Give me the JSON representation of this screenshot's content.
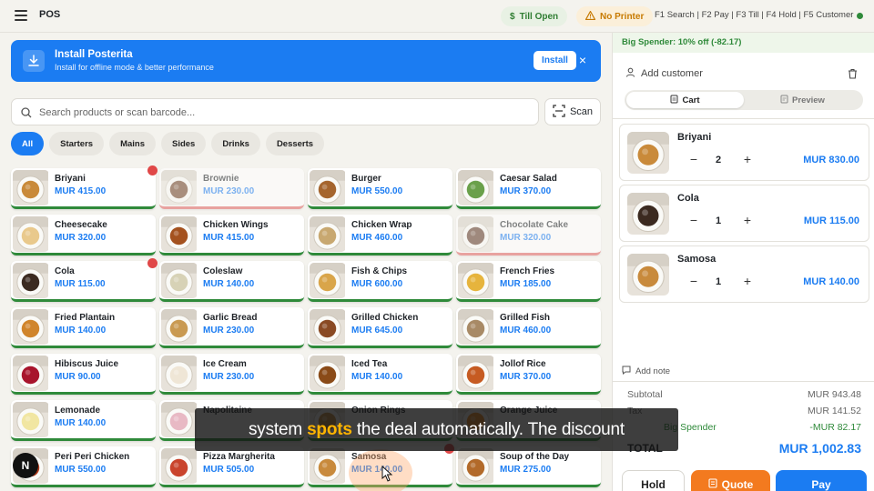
{
  "topbar": {
    "title": "POS",
    "till_status": "Till Open",
    "printer_status": "No Printer",
    "shortcuts": "F1 Search | F2 Pay | F3 Till | F4 Hold | F5 Customer",
    "till_icon": "dollar-icon",
    "printer_icon": "warning-icon"
  },
  "install": {
    "title": "Install Posterita",
    "subtitle": "Install for offline mode & better performance",
    "button": "Install",
    "close": "×"
  },
  "search": {
    "placeholder": "Search products or scan barcode...",
    "value": "",
    "scan_label": "Scan"
  },
  "categories": [
    "All",
    "Starters",
    "Mains",
    "Sides",
    "Drinks",
    "Desserts"
  ],
  "active_category": "All",
  "products": [
    {
      "name": "Briyani",
      "price": "MUR 415.00",
      "icon": "briyani-dish",
      "in_cart": true,
      "available": true
    },
    {
      "name": "Brownie",
      "price": "MUR 230.00",
      "icon": "brownie-dish",
      "in_cart": false,
      "available": false
    },
    {
      "name": "Burger",
      "price": "MUR 550.00",
      "icon": "burger-dish",
      "in_cart": false,
      "available": true
    },
    {
      "name": "Caesar Salad",
      "price": "MUR 370.00",
      "icon": "salad-dish",
      "in_cart": false,
      "available": true
    },
    {
      "name": "Cheesecake",
      "price": "MUR 320.00",
      "icon": "cheesecake-dish",
      "in_cart": false,
      "available": true
    },
    {
      "name": "Chicken Wings",
      "price": "MUR 415.00",
      "icon": "wings-dish",
      "in_cart": false,
      "available": true
    },
    {
      "name": "Chicken Wrap",
      "price": "MUR 460.00",
      "icon": "wrap-dish",
      "in_cart": false,
      "available": true
    },
    {
      "name": "Chocolate Cake",
      "price": "MUR 320.00",
      "icon": "cake-dish",
      "in_cart": false,
      "available": false
    },
    {
      "name": "Cola",
      "price": "MUR 115.00",
      "icon": "cola-drink",
      "in_cart": true,
      "available": true
    },
    {
      "name": "Coleslaw",
      "price": "MUR 140.00",
      "icon": "coleslaw-dish",
      "in_cart": false,
      "available": true
    },
    {
      "name": "Fish & Chips",
      "price": "MUR 600.00",
      "icon": "fish-chips-dish",
      "in_cart": false,
      "available": true
    },
    {
      "name": "French Fries",
      "price": "MUR 185.00",
      "icon": "fries-dish",
      "in_cart": false,
      "available": true
    },
    {
      "name": "Fried Plantain",
      "price": "MUR 140.00",
      "icon": "plantain-dish",
      "in_cart": false,
      "available": true
    },
    {
      "name": "Garlic Bread",
      "price": "MUR 230.00",
      "icon": "bread-dish",
      "in_cart": false,
      "available": true
    },
    {
      "name": "Grilled Chicken",
      "price": "MUR 645.00",
      "icon": "chicken-dish",
      "in_cart": false,
      "available": true
    },
    {
      "name": "Grilled Fish",
      "price": "MUR 460.00",
      "icon": "fish-dish",
      "in_cart": false,
      "available": true
    },
    {
      "name": "Hibiscus Juice",
      "price": "MUR 90.00",
      "icon": "hibiscus-drink",
      "in_cart": false,
      "available": true
    },
    {
      "name": "Ice Cream",
      "price": "MUR 230.00",
      "icon": "icecream-dish",
      "in_cart": false,
      "available": true
    },
    {
      "name": "Iced Tea",
      "price": "MUR 140.00",
      "icon": "icedtea-drink",
      "in_cart": false,
      "available": true
    },
    {
      "name": "Jollof Rice",
      "price": "MUR 370.00",
      "icon": "jollof-dish",
      "in_cart": false,
      "available": true
    },
    {
      "name": "Lemonade",
      "price": "MUR 140.00",
      "icon": "lemonade-drink",
      "in_cart": false,
      "available": true
    },
    {
      "name": "Napolitaine",
      "price": "",
      "icon": "napolitaine-dish",
      "in_cart": false,
      "available": true
    },
    {
      "name": "Onion Rings",
      "price": "",
      "icon": "onion-rings-dish",
      "in_cart": false,
      "available": true
    },
    {
      "name": "Orange Juice",
      "price": "",
      "icon": "orange-drink",
      "in_cart": false,
      "available": true
    },
    {
      "name": "Peri Peri Chicken",
      "price": "MUR 550.00",
      "icon": "peri-chicken-dish",
      "in_cart": false,
      "available": true
    },
    {
      "name": "Pizza Margherita",
      "price": "MUR 505.00",
      "icon": "pizza-dish",
      "in_cart": false,
      "available": true
    },
    {
      "name": "Samosa",
      "price": "MUR 140.00",
      "icon": "samosa-dish",
      "in_cart": true,
      "available": true
    },
    {
      "name": "Soup of the Day",
      "price": "MUR 275.00",
      "icon": "soup-dish",
      "in_cart": false,
      "available": true
    }
  ],
  "cart": {
    "promo": "Big Spender: 10% off (-82.17)",
    "add_customer": "Add customer",
    "tab_cart": "Cart",
    "tab_preview": "Preview",
    "items": [
      {
        "name": "Briyani",
        "qty": "2",
        "price": "MUR 830.00",
        "icon": "briyani-dish"
      },
      {
        "name": "Cola",
        "qty": "1",
        "price": "MUR 115.00",
        "icon": "cola-drink"
      },
      {
        "name": "Samosa",
        "qty": "1",
        "price": "MUR 140.00",
        "icon": "samosa-dish"
      }
    ],
    "add_note": "Add note",
    "subtotal_label": "Subtotal",
    "subtotal": "MUR 943.48",
    "tax_label": "Tax",
    "tax": "MUR 141.52",
    "discount_label": "Big Spender",
    "discount": "-MUR 82.17",
    "total_label": "TOTAL",
    "total": "MUR 1,002.83",
    "hold_label": "Hold",
    "quote_label": "Quote",
    "pay_label": "Pay"
  },
  "caption": {
    "before": "system ",
    "highlight": "spots",
    "after": " the deal automatically. The discount"
  },
  "corner_badge": "N",
  "colors": {
    "accent": "#1b7cf2",
    "success": "#2f8a3a",
    "warning": "#c77a00",
    "quote": "#f37a1f",
    "danger": "#e04848"
  }
}
